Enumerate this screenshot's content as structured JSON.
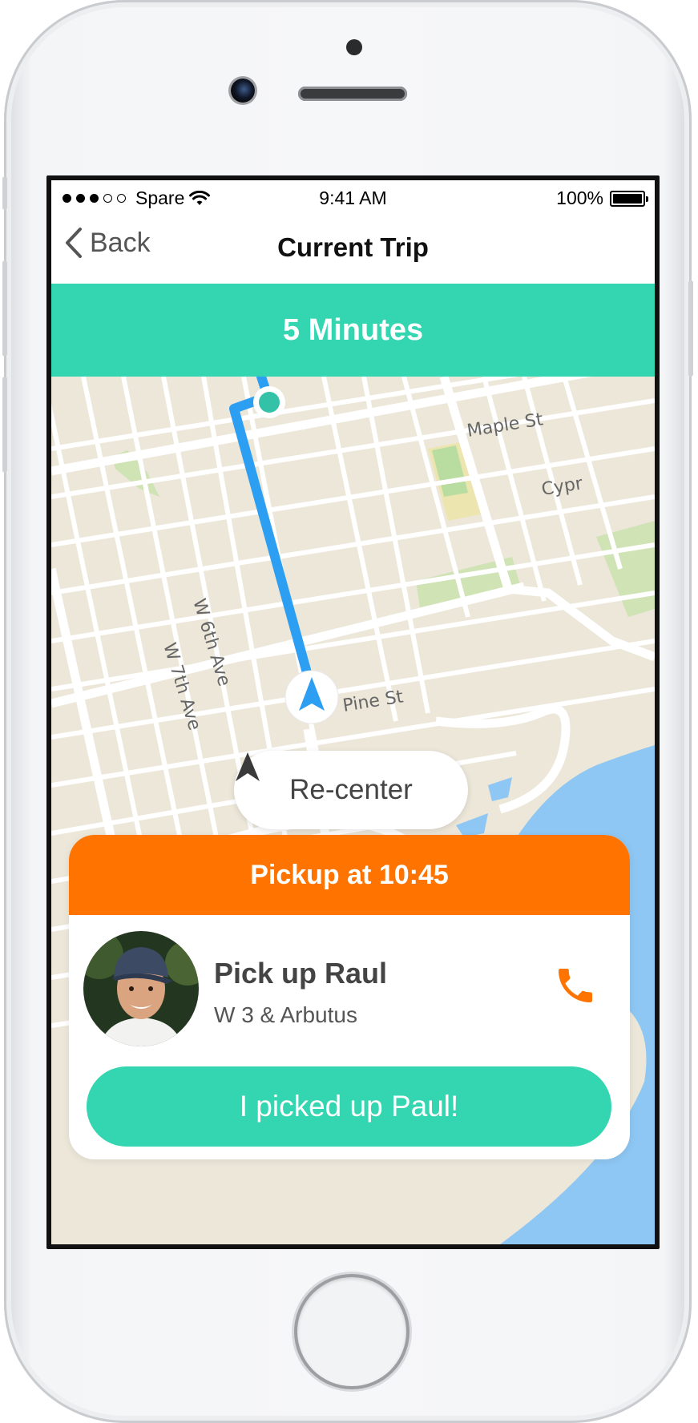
{
  "status_bar": {
    "carrier": "Spare",
    "time": "9:41 AM",
    "battery": "100%",
    "signal_bars_filled": 3,
    "signal_bars_total": 5
  },
  "nav": {
    "back_label": "Back",
    "title": "Current Trip"
  },
  "eta": {
    "label": "5 Minutes",
    "color": "#33d6b0"
  },
  "map": {
    "street_labels": [
      "Maple St",
      "Cypr",
      "W 6th Ave",
      "W 7th Ave",
      "Pine St"
    ],
    "route_color": "#2d9ff3",
    "destination_color": "#33c2a8"
  },
  "recenter": {
    "label": "Re-center",
    "icon": "navigation-arrow-icon"
  },
  "pickup_card": {
    "header": "Pickup at 10:45",
    "header_color": "#ff7400",
    "rider_name": "Pick up Raul",
    "location": "W 3 & Arbutus",
    "call_icon": "phone-icon",
    "confirm_label": "I picked up Paul!",
    "confirm_color": "#33d6b0"
  }
}
